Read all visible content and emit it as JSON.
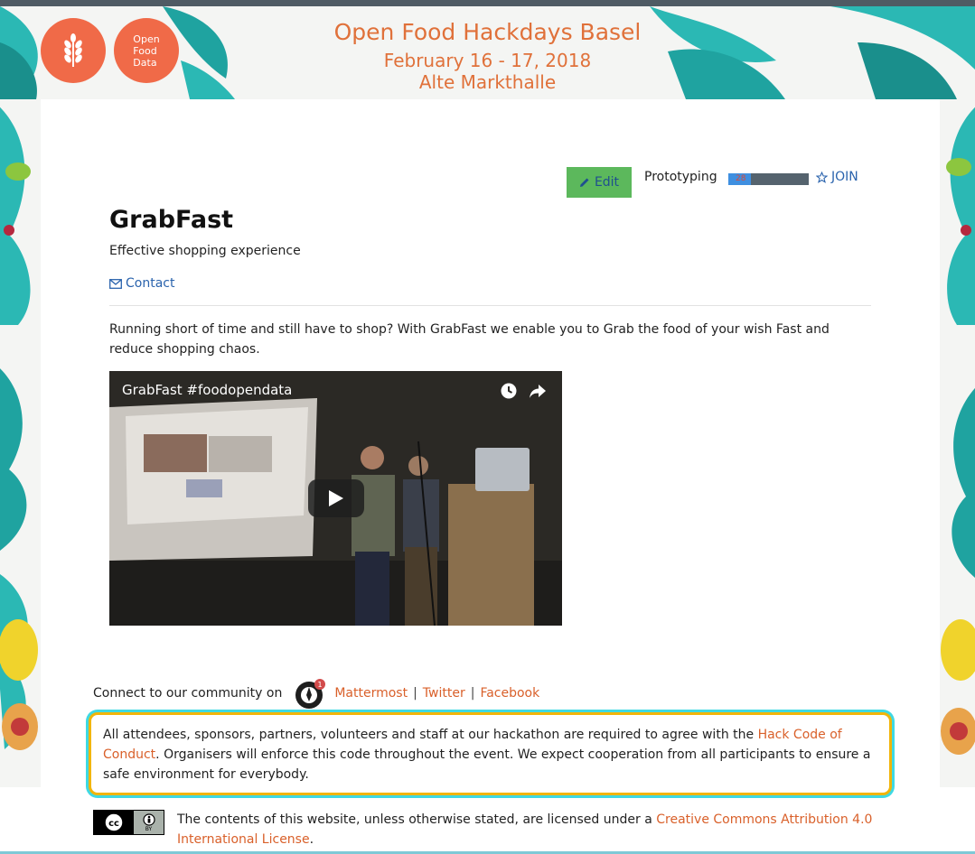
{
  "banner": {
    "title": "Open Food Hackdays Basel",
    "date": "February 16 - 17, 2018",
    "venue": "Alte Markthalle",
    "logo_text": [
      "Open",
      "Food",
      "Data"
    ]
  },
  "project": {
    "edit_label": "Edit",
    "stage": "Prototyping",
    "progress_value": "28",
    "progress_percent": 28,
    "join_label": "JOIN",
    "title": "GrabFast",
    "subtitle": "Effective shopping experience",
    "contact_label": "Contact",
    "description": "Running short of time and still have to shop? With GrabFast we enable you to Grab the food of your wish Fast and reduce shopping chaos."
  },
  "video": {
    "title": "GrabFast #foodopendata"
  },
  "community": {
    "intro": "Connect to our community on",
    "mattermost_badge": "1",
    "links": [
      "Mattermost",
      "Twitter",
      "Facebook"
    ],
    "separator": "|"
  },
  "conduct": {
    "text_before": "All attendees, sponsors, partners, volunteers and staff at our hackathon are required to agree with the ",
    "link": "Hack Code of Conduct",
    "text_after": ". Organisers will enforce this code throughout the event. We expect cooperation from all participants to ensure a safe environment for everybody."
  },
  "license": {
    "badge_cc": "cc",
    "badge_by": "BY",
    "text": "The contents of this website, unless otherwise stated, are licensed under a ",
    "link": "Creative Commons Attribution 4.0 International License",
    "end": "."
  },
  "colors": {
    "accent_orange": "#e0713a",
    "link_blue": "#2a63ad",
    "edit_green": "#5cb85c",
    "coc_border": "#f2b50a",
    "coc_glow": "#3fd9e3"
  },
  "icons": [
    "wheat-icon",
    "pencil-icon",
    "star-icon",
    "envelope-icon",
    "clock-icon",
    "share-icon",
    "play-icon",
    "mattermost-icon",
    "cc-icon",
    "by-icon"
  ]
}
